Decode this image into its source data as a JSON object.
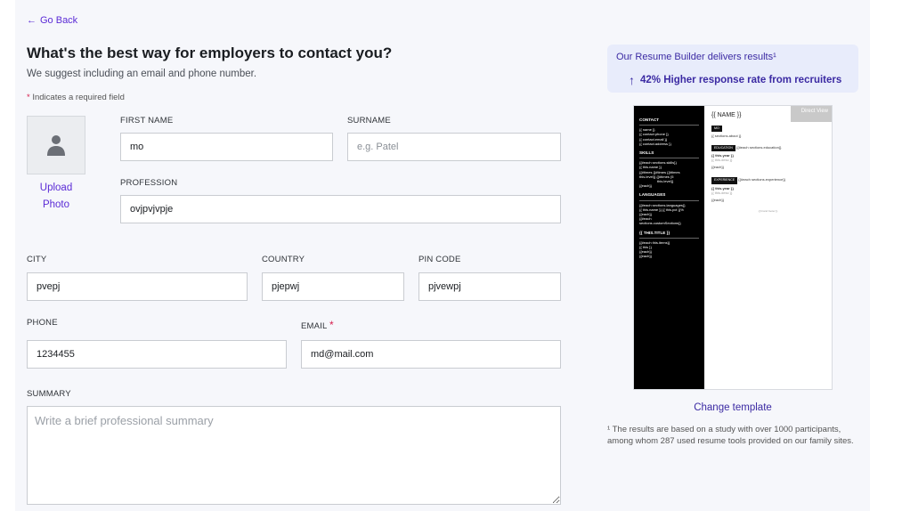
{
  "nav": {
    "back_icon": "arrow-left-icon",
    "back_label": "Go Back"
  },
  "header": {
    "title": "What's the best way for employers to contact you?",
    "subtitle": "We suggest including an email and phone number.",
    "required_star": "*",
    "required_note": "Indicates a required field"
  },
  "photo": {
    "icon": "person-silhouette-icon",
    "upload_line1": "Upload",
    "upload_line2": "Photo"
  },
  "form": {
    "first_name": {
      "label": "FIRST NAME",
      "value": "mo",
      "placeholder": ""
    },
    "surname": {
      "label": "SURNAME",
      "value": "",
      "placeholder": "e.g. Patel"
    },
    "profession": {
      "label": "PROFESSION",
      "value": "ovjpvjvpje",
      "placeholder": ""
    },
    "city": {
      "label": "CITY",
      "value": "pvepj",
      "placeholder": ""
    },
    "country": {
      "label": "COUNTRY",
      "value": "pjepwj",
      "placeholder": ""
    },
    "pin_code": {
      "label": "PIN CODE",
      "value": "pjvewpj",
      "placeholder": ""
    },
    "phone": {
      "label": "PHONE",
      "value": "1234455",
      "placeholder": ""
    },
    "email": {
      "label": "EMAIL",
      "required_star": "*",
      "value": "md@mail.com",
      "placeholder": ""
    },
    "summary": {
      "label": "SUMMARY",
      "value": "",
      "placeholder": "Write a brief professional summary"
    }
  },
  "sidebar": {
    "results_title": "Our Resume Builder delivers results¹",
    "results_icon": "arrow-up-icon",
    "results_stat": "42% Higher response rate from recruiters",
    "change_template": "Change template",
    "footnote": "¹ The results are based on a study with over 1000 participants, among whom 287 used resume tools provided on our family sites."
  },
  "template_preview": {
    "direct_view": "Direct View",
    "name": "{{ NAME }}",
    "contact_heading": "CONTACT",
    "contact_lines": [
      "{{ name }}",
      "{{ contact.phone }}",
      "{{ contact.email }}",
      "{{ contact.address }}"
    ],
    "skills_heading": "SKILLS",
    "skills_lines": [
      "{{#each sections.skills}}",
      "{{ this.name }}",
      "{{#times {{#times {{#times",
      "this.level}} {{#times (5",
      "this.level}}",
      "{{each}}"
    ],
    "languages_heading": "LANGUAGES",
    "languages_lines": [
      "{{#each sections.languages}}",
      "{{ this.name }} {{ this.pct }}%",
      "{{each}}",
      "{{#each",
      "sections.customSections}}"
    ],
    "title_heading": "{{ THIS.TITLE }}",
    "title_lines": [
      "{{#each this.items}}",
      "{{ this }}",
      "{{each}}",
      "{{each}}"
    ],
    "about_badge": "MO",
    "about_line": "{{ sections.about }}",
    "education_badge": "EDUCATION",
    "education_each": "{{#each sections.education}}",
    "education_lines": [
      "{{ this.year }}",
      "{{ this.desc }}",
      "{{each}}"
    ],
    "experience_badge": "EXPERIENCE",
    "experience_each": "{{#each sections.experience}}",
    "experience_lines": [
      "{{ this.year }}",
      "{{ this.desc }}",
      "{{each}}"
    ],
    "footer": "{{ brand footer }}"
  }
}
